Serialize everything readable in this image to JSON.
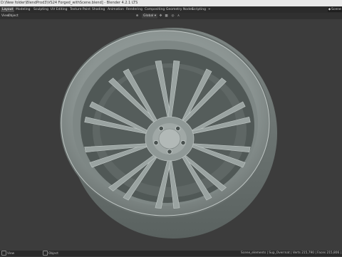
{
  "window": {
    "title": "D:\\New folder\\BlendProd3\\VS24 Forged_withScene.blend] - Blender 4.2.1 LTS"
  },
  "workspace_tabs": [
    {
      "label": "Layout",
      "active": true
    },
    {
      "label": "Modeling",
      "active": false
    },
    {
      "label": "Sculpting",
      "active": false
    },
    {
      "label": "UV Editing",
      "active": false
    },
    {
      "label": "Texture Paint",
      "active": false
    },
    {
      "label": "Shading",
      "active": false
    },
    {
      "label": "Animation",
      "active": false
    },
    {
      "label": "Rendering",
      "active": false
    },
    {
      "label": "Compositing",
      "active": false
    },
    {
      "label": "Geometry Nodes",
      "active": false
    },
    {
      "label": "Scripting",
      "active": false
    }
  ],
  "add_workspace_label": "+",
  "scene_field": {
    "label": "Scene"
  },
  "viewport_header": {
    "menus": [
      "View",
      "Object"
    ],
    "orientation": "Global"
  },
  "statusbar": {
    "left_hint": "View",
    "center_hint": "Object",
    "stats": "Scene_elements | Sup_Overrnat | Verts 215,790 | Faces 215,806 | Tris 431,6"
  },
  "colors": {
    "viewport_bg": "#3c3c3c",
    "wheel_base": "#8d9694",
    "wheel_highlight": "#b6bdbb",
    "wheel_shadow": "#5f6765"
  }
}
